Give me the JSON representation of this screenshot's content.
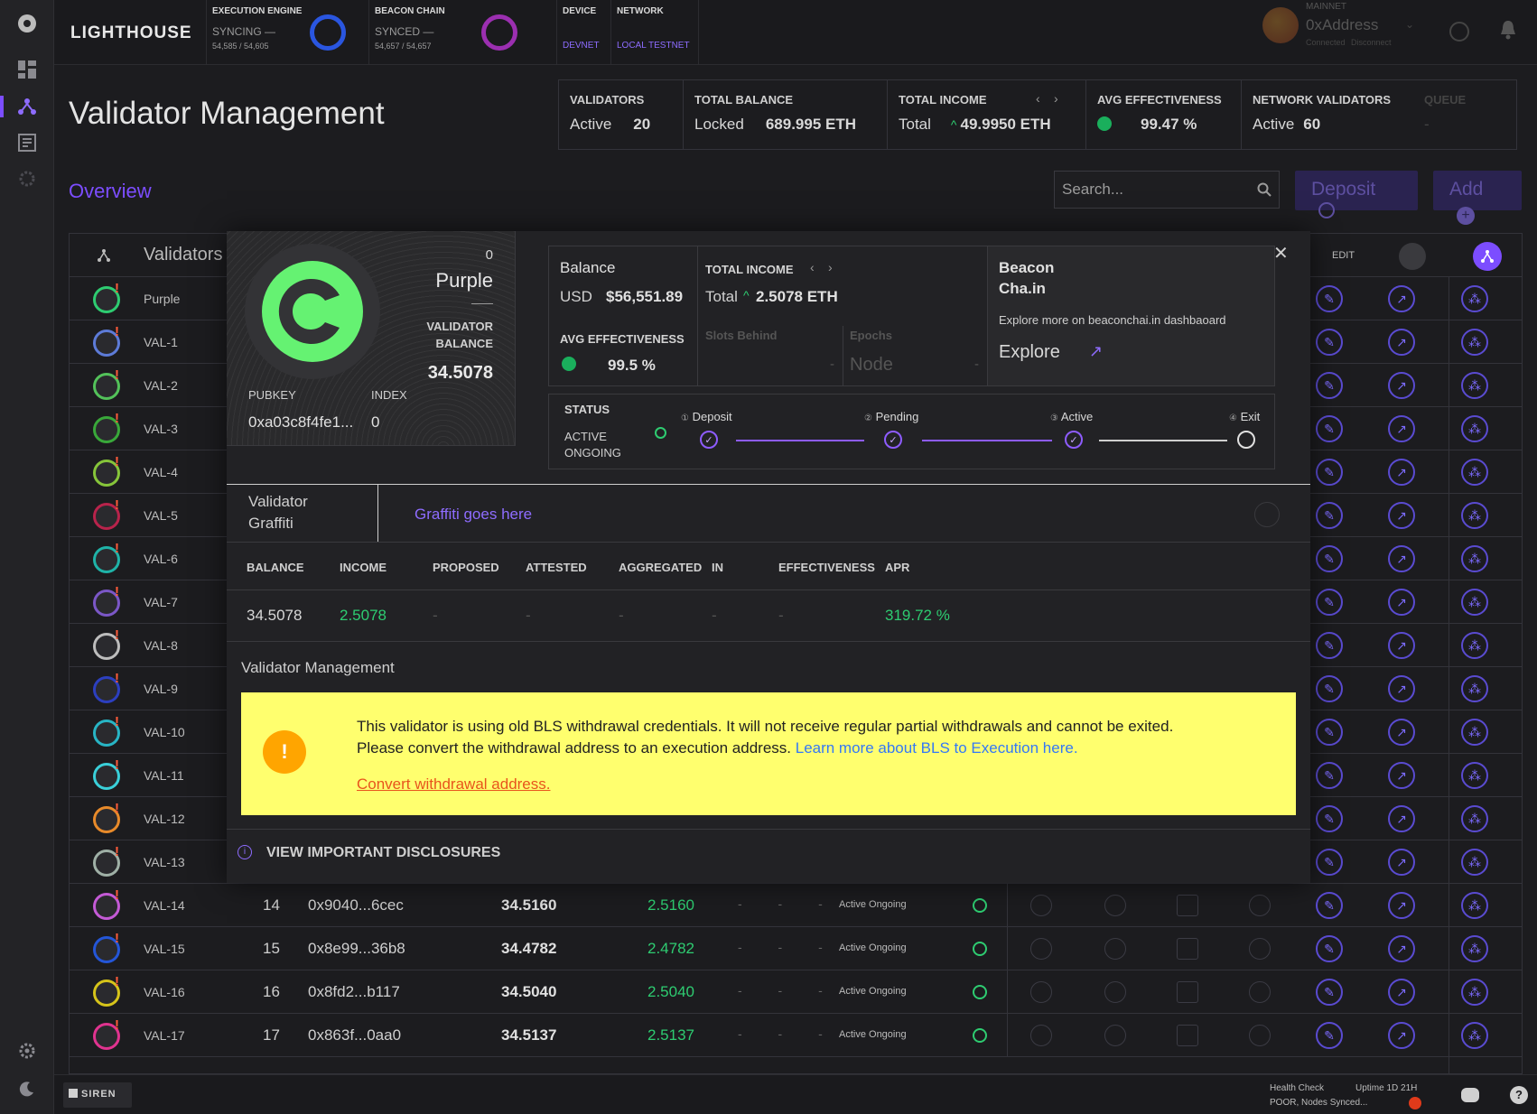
{
  "app": {
    "logo": "LIGHTHOUSE",
    "footer_brand": "SIREN"
  },
  "topbar": {
    "execution": {
      "label": "EXECUTION ENGINE",
      "status": "SYNCING —",
      "progress": "54,585 / 54,605"
    },
    "beacon": {
      "label": "BEACON CHAIN",
      "status": "SYNCED —",
      "progress": "54,657 / 54,657"
    },
    "device": {
      "label": "DEVICE",
      "value": "DEVNET"
    },
    "network": {
      "label": "NETWORK",
      "value": "LOCAL TESTNET"
    },
    "account": {
      "network": "MAINNET",
      "address": "0xAddress",
      "connected": "Connected",
      "disconnect": "Disconnect"
    }
  },
  "page": {
    "title": "Validator Management",
    "tab": "Overview"
  },
  "stats": {
    "validators": {
      "label": "VALIDATORS",
      "sub": "Active",
      "value": "20"
    },
    "balance": {
      "label": "TOTAL BALANCE",
      "sub": "Locked",
      "value": "689.995 ETH"
    },
    "income": {
      "label": "TOTAL INCOME",
      "sub": "Total",
      "value": "49.9950 ETH"
    },
    "effectiveness": {
      "label": "AVG EFFECTIVENESS",
      "value": "99.47 %"
    },
    "network": {
      "label": "NETWORK VALIDATORS",
      "sub": "Active",
      "value": "60"
    },
    "queue": {
      "label": "QUEUE",
      "value": "-"
    }
  },
  "search": {
    "placeholder": "Search..."
  },
  "buttons": {
    "deposit": "Deposit",
    "add": "Add"
  },
  "table": {
    "title": "Validators",
    "edit_label": "EDIT",
    "rows": [
      {
        "name": "Purple",
        "color": "#2ecc71"
      },
      {
        "name": "VAL-1",
        "color": "#5d7bd8"
      },
      {
        "name": "VAL-2",
        "color": "#53c25a"
      },
      {
        "name": "VAL-3",
        "color": "#39a83a"
      },
      {
        "name": "VAL-4",
        "color": "#86c53a"
      },
      {
        "name": "VAL-5",
        "color": "#b8234b"
      },
      {
        "name": "VAL-6",
        "color": "#1fb3a8"
      },
      {
        "name": "VAL-7",
        "color": "#7b57c7"
      },
      {
        "name": "VAL-8",
        "color": "#bdbdbd"
      },
      {
        "name": "VAL-9",
        "color": "#2c3fbf"
      },
      {
        "name": "VAL-10",
        "color": "#28b5c5"
      },
      {
        "name": "VAL-11",
        "color": "#3ad0d9"
      },
      {
        "name": "VAL-12",
        "color": "#e88a2a"
      },
      {
        "name": "VAL-13",
        "color": "#9fb0a6"
      },
      {
        "name": "VAL-14",
        "index": "14",
        "pubkey": "0x9040...6cec",
        "balance": "34.5160",
        "income": "2.5160",
        "status": "Active Ongoing",
        "color": "#c45ad6"
      },
      {
        "name": "VAL-15",
        "index": "15",
        "pubkey": "0x8e99...36b8",
        "balance": "34.4782",
        "income": "2.4782",
        "status": "Active Ongoing",
        "color": "#2456d8"
      },
      {
        "name": "VAL-16",
        "index": "16",
        "pubkey": "0x8fd2...b117",
        "balance": "34.5040",
        "income": "2.5040",
        "status": "Active Ongoing",
        "color": "#d6c41a"
      },
      {
        "name": "VAL-17",
        "index": "17",
        "pubkey": "0x863f...0aa0",
        "balance": "34.5137",
        "income": "2.5137",
        "status": "Active Ongoing",
        "color": "#e0338f"
      }
    ]
  },
  "modal": {
    "card": {
      "index_top": "0",
      "name": "Purple",
      "balance_label": "VALIDATOR BALANCE",
      "balance": "34.5078",
      "pubkey_label": "PUBKEY",
      "pubkey": "0xa03c8f4fe1...",
      "index_label": "INDEX",
      "index": "0"
    },
    "balance": {
      "label": "Balance",
      "currency": "USD",
      "value": "$56,551.89"
    },
    "income": {
      "label": "TOTAL INCOME",
      "sub": "Total",
      "value": "2.5078 ETH",
      "slots_label": "Slots Behind",
      "slots_value": "-",
      "epochs_label": "Epochs",
      "epochs_value": "Node",
      "epochs_dash": "-"
    },
    "effectiveness": {
      "label": "AVG EFFECTIVENESS",
      "value": "99.5 %"
    },
    "beacon": {
      "title_line1": "Beacon",
      "title_line2": "Cha.in",
      "desc": "Explore more on beaconchai.in dashbaoard",
      "link": "Explore"
    },
    "status": {
      "label": "STATUS",
      "state_line1": "ACTIVE",
      "state_line2": "ONGOING",
      "steps": [
        {
          "num": "①",
          "label": "Deposit"
        },
        {
          "num": "②",
          "label": "Pending"
        },
        {
          "num": "③",
          "label": "Active"
        },
        {
          "num": "④",
          "label": "Exit"
        }
      ]
    },
    "graffiti": {
      "label_line1": "Validator",
      "label_line2": "Graffiti",
      "value": "Graffiti goes here"
    },
    "metrics": {
      "headers": [
        "BALANCE",
        "INCOME",
        "PROPOSED",
        "ATTESTED",
        "AGGREGATED",
        "IN",
        "EFFECTIVENESS",
        "APR"
      ],
      "values": [
        "34.5078",
        "2.5078",
        "-",
        "-",
        "-",
        "-",
        "-",
        "319.72 %"
      ]
    },
    "management": {
      "title": "Validator Management",
      "warning_line1": "This validator is using old BLS withdrawal credentials. It will not receive regular partial withdrawals and cannot be exited.",
      "warning_line2": "Please convert the withdrawal address to an execution address.",
      "learn_more": "Learn more about BLS to Execution here.",
      "convert": "Convert withdrawal address."
    },
    "disclosures": "VIEW IMPORTANT DISCLOSURES"
  },
  "footer": {
    "health_label": "Health Check",
    "health_value": "POOR, Nodes Synced...",
    "uptime": "Uptime 1D 21H"
  }
}
